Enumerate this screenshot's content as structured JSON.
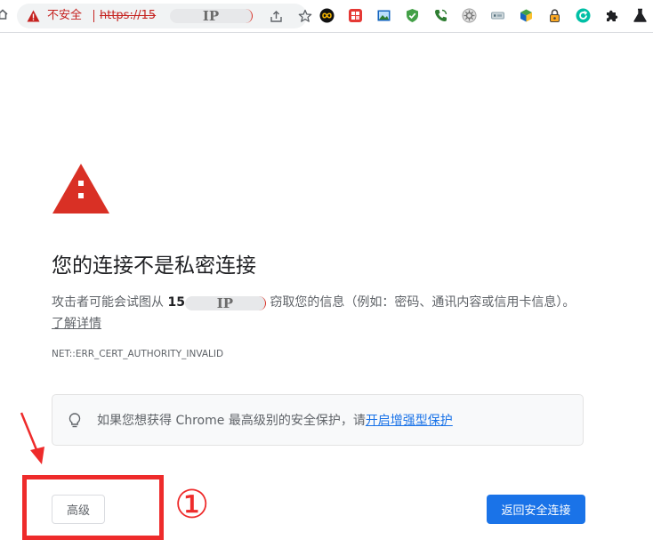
{
  "browser": {
    "security_label": "不安全",
    "url_prefix": "https://15",
    "url_redaction": "IP"
  },
  "extensions": [
    "infinity-icon",
    "grid-app-icon",
    "image-icon",
    "shield-check-icon",
    "phone-icon",
    "gear-circle-icon",
    "tag-icon",
    "cube-icon",
    "lock-icon",
    "refresh-circle-icon",
    "puzzle-icon",
    "flask-icon"
  ],
  "page": {
    "heading": "您的连接不是私密连接",
    "body_before": "攻击者可能会试图从 ",
    "ip_prefix": "15",
    "ip_redaction": "IP",
    "body_after": " 窃取您的信息（例如：密码、通讯内容或信用卡信息）。",
    "learn_more": "了解详情",
    "error_code": "NET::ERR_CERT_AUTHORITY_INVALID",
    "enhanced_text": "如果您想获得 Chrome 最高级别的安全保护，请",
    "enhanced_link": "开启增强型保护",
    "advanced_label": "高级",
    "back_label": "返回安全连接"
  },
  "annotation": {
    "step_number": "①",
    "color": "#ee2b2b"
  },
  "colors": {
    "danger": "#c5221f",
    "accent": "#1a73e8",
    "warning_triangle": "#d93025"
  }
}
